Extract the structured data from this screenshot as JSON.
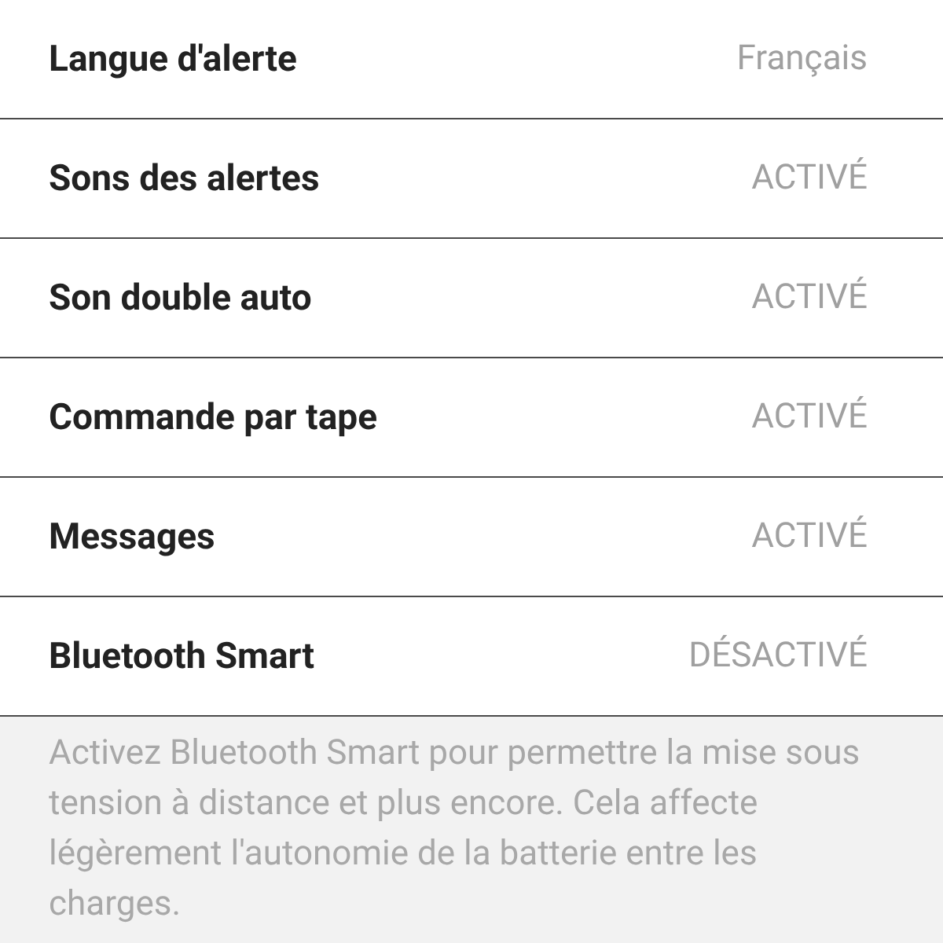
{
  "settings": [
    {
      "label": "Langue d'alerte",
      "value": "Français"
    },
    {
      "label": "Sons des alertes",
      "value": "ACTIVÉ"
    },
    {
      "label": "Son double auto",
      "value": "ACTIVÉ"
    },
    {
      "label": "Commande par tape",
      "value": "ACTIVÉ"
    },
    {
      "label": "Messages",
      "value": "ACTIVÉ"
    },
    {
      "label": "Bluetooth Smart",
      "value": "DÉSACTIVÉ"
    }
  ],
  "description": "Activez Bluetooth Smart pour permettre la mise sous tension à distance et plus encore. Cela affecte légèrement l'autonomie de la batterie entre les charges."
}
